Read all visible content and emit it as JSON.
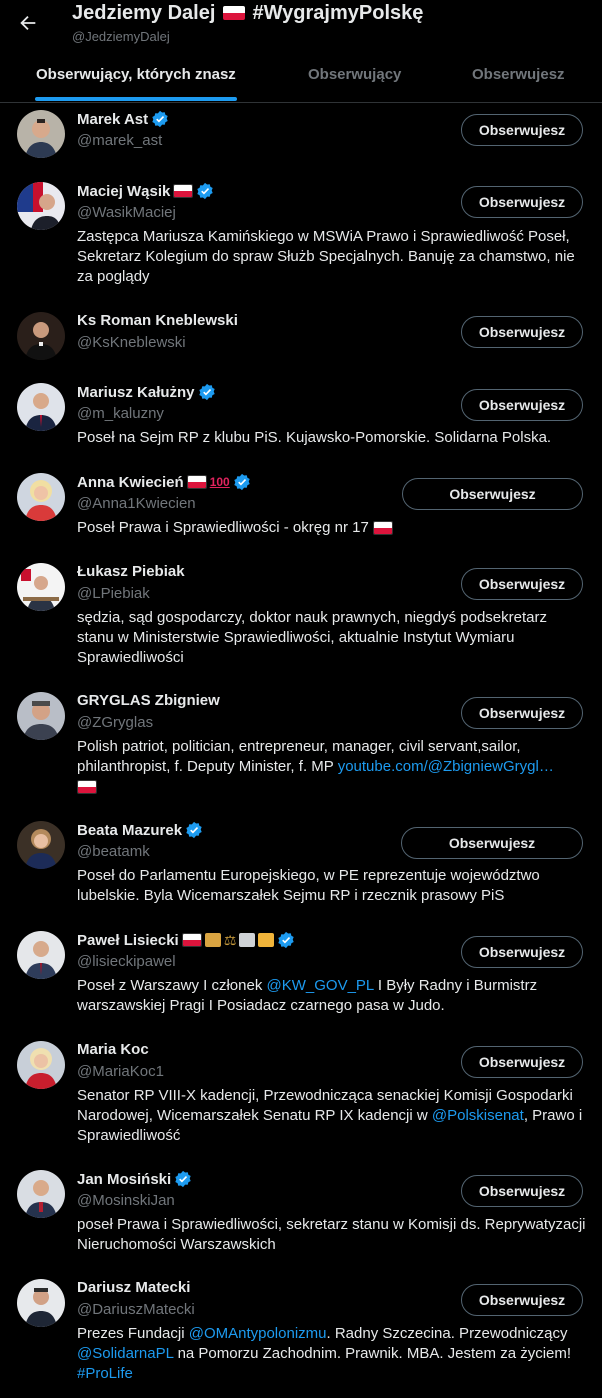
{
  "header": {
    "title": "Jedziemy Dalej",
    "title_hashtag": "#WygrajmyPolskę",
    "handle": "@JedziemyDalej"
  },
  "tabs": [
    {
      "label": "Obserwujący, których znasz",
      "active": true
    },
    {
      "label": "Obserwujący",
      "active": false
    },
    {
      "label": "Obserwujesz",
      "active": false
    }
  ],
  "colors": {
    "accent": "#1d9bf0",
    "background": "#000000",
    "muted": "#71767b",
    "text": "#e7e9ea",
    "border": "#536471"
  },
  "users": [
    {
      "name": "Marek Ast",
      "handle": "@marek_ast",
      "verified": true,
      "bio": "",
      "button": "Obserwujesz"
    },
    {
      "name": "Maciej Wąsik",
      "handle": "@WasikMaciej",
      "verified": true,
      "badges": [
        "polish-flag"
      ],
      "bio": "Zastępca Mariusza Kamińskiego w MSWiA Prawo i Sprawiedliwość Poseł, Sekretarz Kolegium do spraw Służb Specjalnych. Banuję za chamstwo, nie za poglądy",
      "button": "Obserwujesz"
    },
    {
      "name": "Ks Roman Kneblewski",
      "handle": "@KsKneblewski",
      "verified": false,
      "bio": "",
      "button": "Obserwujesz"
    },
    {
      "name": "Mariusz Kałużny",
      "handle": "@m_kaluzny",
      "verified": true,
      "bio": "Poseł na Sejm RP z klubu PiS. Kujawsko-Pomorskie. Solidarna Polska.",
      "button": "Obserwujesz"
    },
    {
      "name": "Anna Kwiecień",
      "handle": "@Anna1Kwiecien",
      "verified": true,
      "badges": [
        "polish-flag",
        "hundred-emoji"
      ],
      "bio": "Poseł Prawa i Sprawiedliwości - okręg nr 17",
      "bio_badge": "polish-flag",
      "button": "Obserwujesz"
    },
    {
      "name": "Łukasz Piebiak",
      "handle": "@LPiebiak",
      "verified": false,
      "bio": "sędzia, sąd gospodarczy, doktor nauk prawnych, niegdyś podsekretarz stanu w Ministerstwie Sprawiedliwości, aktualnie Instytut Wymiaru Sprawiedliwości",
      "button": "Obserwujesz"
    },
    {
      "name": "GRYGLAS Zbigniew",
      "handle": "@ZGryglas",
      "verified": false,
      "bio": "Polish patriot, politician, entrepreneur, manager, civil servant,sailor, philanthropist, f. Deputy Minister, f. MP",
      "bio_link": "youtube.com/@ZbigniewGrygl…",
      "bio_badge": "polish-flag",
      "button": "Obserwujesz"
    },
    {
      "name": "Beata Mazurek",
      "handle": "@beatamk",
      "verified": true,
      "bio": "Poseł do Parlamentu Europejskiego, w PE reprezentuje województwo lubelskie. Byla Wicemarszałek Sejmu RP i rzecznik prasowy PiS",
      "button": "Obserwujesz"
    },
    {
      "name": "Paweł Lisiecki",
      "handle": "@lisieckipawel",
      "verified": true,
      "badges": [
        "polish-flag",
        "scroll-emoji",
        "scales-emoji",
        "classical-building-emoji",
        "people-emoji"
      ],
      "bio_parts": [
        "Poseł z Warszawy I członek ",
        "@KW_GOV_PL",
        " I Były Radny i Burmistrz warszawskiej Pragi I Posiadacz czarnego pasa w Judo."
      ],
      "button": "Obserwujesz"
    },
    {
      "name": "Maria Koc",
      "handle": "@MariaKoc1",
      "verified": false,
      "bio_parts": [
        "Senator RP VIII-X kadencji, Przewodnicząca senackiej Komisji Gospodarki Narodowej, Wicemarszałek Senatu RP IX kadencji w ",
        "@Polskisenat",
        ", Prawo i Sprawiedliwość"
      ],
      "button": "Obserwujesz"
    },
    {
      "name": "Jan Mosiński",
      "handle": "@MosinskiJan",
      "verified": true,
      "bio": "poseł Prawa i Sprawiedliwości, sekretarz stanu w Komisji ds. Reprywatyzacji Nieruchomości Warszawskich",
      "button": "Obserwujesz"
    },
    {
      "name": "Dariusz Matecki",
      "handle": "@DariuszMatecki",
      "verified": false,
      "bio_parts": [
        "Prezes Fundacji ",
        "@OMAntypolonizmu",
        ". Radny Szczecina. Przewodniczący ",
        "@SolidarnaPL",
        " na Pomorzu Zachodnim. Prawnik. MBA. Jestem za życiem! ",
        "#ProLife"
      ],
      "button": "Obserwujesz"
    }
  ]
}
